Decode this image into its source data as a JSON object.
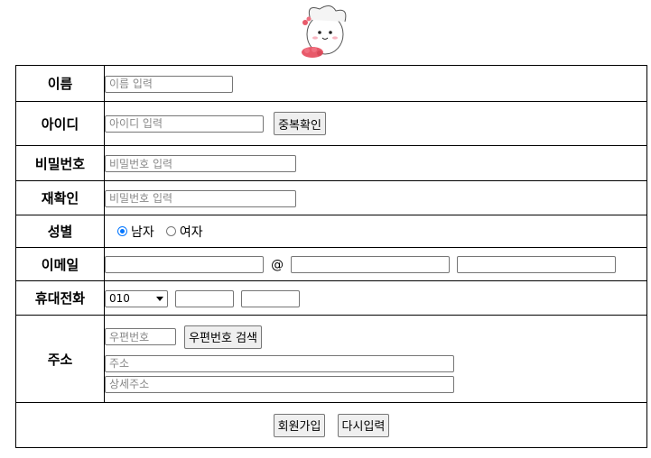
{
  "form": {
    "name": {
      "label": "이름",
      "placeholder": "이름 입력"
    },
    "id": {
      "label": "아이디",
      "placeholder": "아이디 입력",
      "check_button": "중복확인"
    },
    "password": {
      "label": "비밀번호",
      "placeholder": "비밀번호 입력"
    },
    "confirm": {
      "label": "재확인",
      "placeholder": "비밀번호 입력"
    },
    "gender": {
      "label": "성별",
      "options": [
        "남자",
        "여자"
      ],
      "selected": "남자"
    },
    "email": {
      "label": "이메일",
      "at": "@"
    },
    "phone": {
      "label": "휴대전화",
      "prefix": "010"
    },
    "address": {
      "label": "주소",
      "zip_placeholder": "우편번호",
      "zip_button": "우편번호 검색",
      "addr_placeholder": "주소",
      "detail_placeholder": "상세주소"
    },
    "actions": {
      "submit": "회원가입",
      "reset": "다시입력"
    }
  },
  "colors": {
    "accent": "#0075ff",
    "border": "#000000"
  }
}
